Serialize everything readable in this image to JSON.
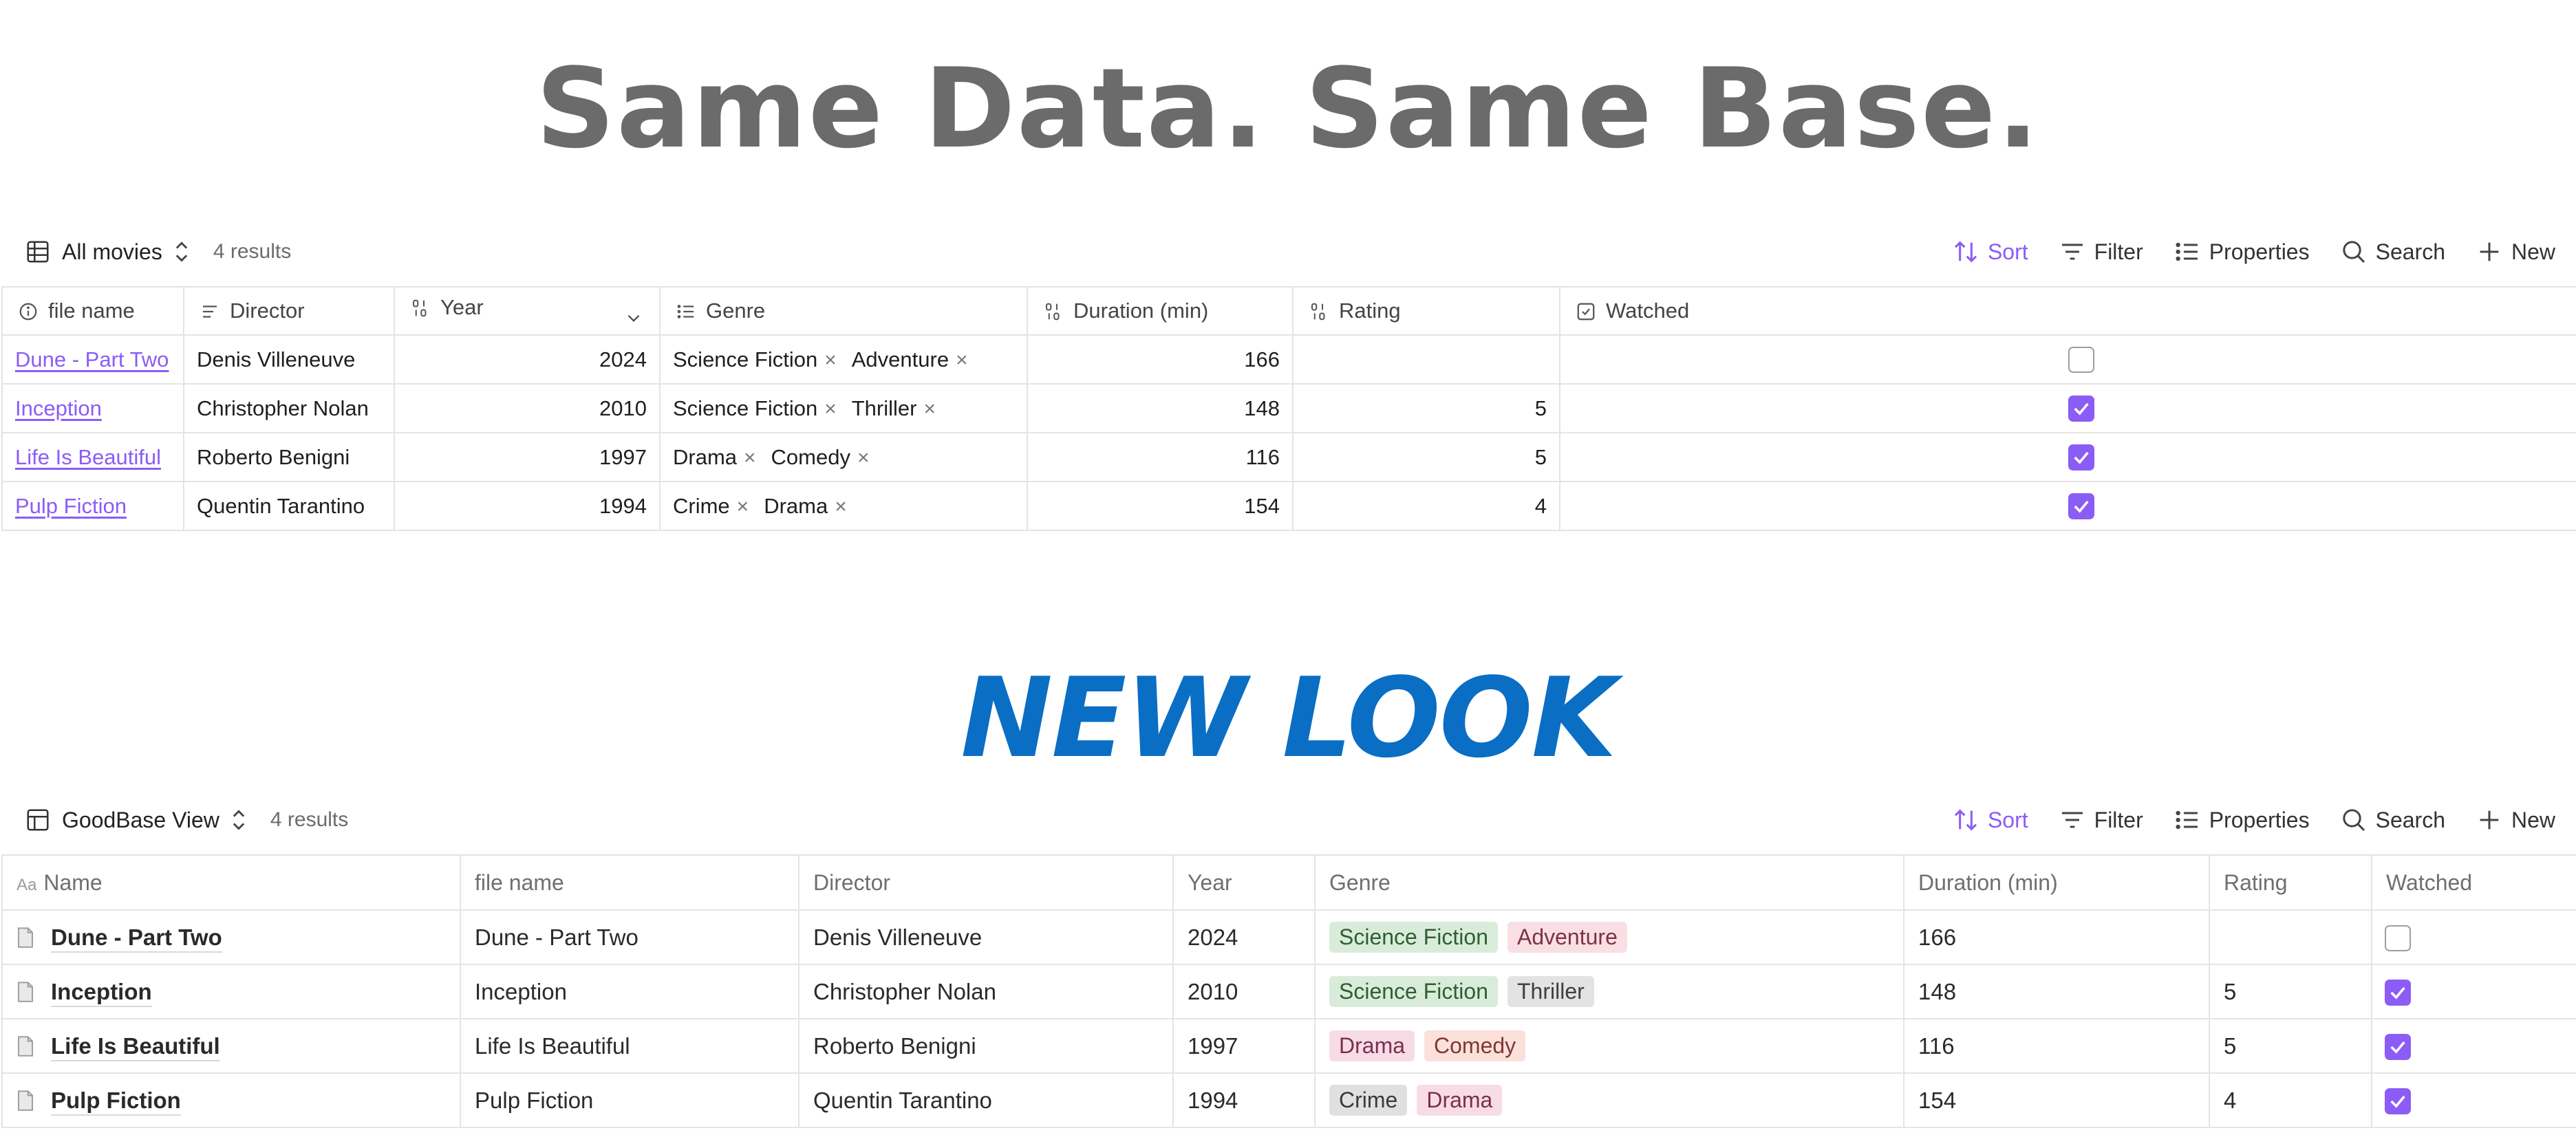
{
  "headline_top": "Same Data. Same Base.",
  "headline_bottom": "NEW LOOK",
  "toolbar": {
    "sort": "Sort",
    "filter": "Filter",
    "properties": "Properties",
    "search": "Search",
    "new": "New"
  },
  "accent_color": "#8b5cf6",
  "view1": {
    "name": "All movies",
    "results": "4 results",
    "headers": [
      "file name",
      "Director",
      "Year",
      "Genre",
      "Duration (min)",
      "Rating",
      "Watched"
    ],
    "rows": [
      {
        "file": "Dune - Part Two",
        "director": "Denis Villeneuve",
        "year": "2024",
        "genres": [
          "Science Fiction",
          "Adventure"
        ],
        "duration": "166",
        "rating": "",
        "watched": false
      },
      {
        "file": "Inception",
        "director": "Christopher Nolan",
        "year": "2010",
        "genres": [
          "Science Fiction",
          "Thriller"
        ],
        "duration": "148",
        "rating": "5",
        "watched": true
      },
      {
        "file": "Life Is Beautiful",
        "director": "Roberto Benigni",
        "year": "1997",
        "genres": [
          "Drama",
          "Comedy"
        ],
        "duration": "116",
        "rating": "5",
        "watched": true
      },
      {
        "file": "Pulp Fiction",
        "director": "Quentin Tarantino",
        "year": "1994",
        "genres": [
          "Crime",
          "Drama"
        ],
        "duration": "154",
        "rating": "4",
        "watched": true
      }
    ]
  },
  "view2": {
    "name": "GoodBase View",
    "results": "4 results",
    "name_prefix": "Aa",
    "headers": [
      "Name",
      "file name",
      "Director",
      "Year",
      "Genre",
      "Duration (min)",
      "Rating",
      "Watched"
    ],
    "rows": [
      {
        "name": "Dune - Part Two",
        "file": "Dune - Part Two",
        "director": "Denis Villeneuve",
        "year": "2024",
        "genres": [
          "Science Fiction",
          "Adventure"
        ],
        "duration": "166",
        "rating": "",
        "watched": false
      },
      {
        "name": "Inception",
        "file": "Inception",
        "director": "Christopher Nolan",
        "year": "2010",
        "genres": [
          "Science Fiction",
          "Thriller"
        ],
        "duration": "148",
        "rating": "5",
        "watched": true
      },
      {
        "name": "Life Is Beautiful",
        "file": "Life Is Beautiful",
        "director": "Roberto Benigni",
        "year": "1997",
        "genres": [
          "Drama",
          "Comedy"
        ],
        "duration": "116",
        "rating": "5",
        "watched": true
      },
      {
        "name": "Pulp Fiction",
        "file": "Pulp Fiction",
        "director": "Quentin Tarantino",
        "year": "1994",
        "genres": [
          "Crime",
          "Drama"
        ],
        "duration": "154",
        "rating": "4",
        "watched": true
      }
    ],
    "tag_colors": {
      "Science Fiction": {
        "bg": "#d9ecd9",
        "fg": "#2f5e34"
      },
      "Adventure": {
        "bg": "#f9dfe4",
        "fg": "#7d3345"
      },
      "Thriller": {
        "bg": "#e3e3e3",
        "fg": "#3f3f3f"
      },
      "Drama": {
        "bg": "#f7dce6",
        "fg": "#7a2f4d"
      },
      "Comedy": {
        "bg": "#fbe0dc",
        "fg": "#7f3a2e"
      },
      "Crime": {
        "bg": "#e0e0e0",
        "fg": "#3a3a3a"
      }
    }
  }
}
